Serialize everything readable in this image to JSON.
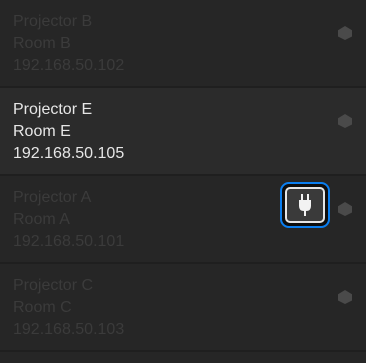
{
  "projectors": [
    {
      "name": "Projector B",
      "room": "Room B",
      "ip": "192.168.50.102",
      "selected": false
    },
    {
      "name": "Projector E",
      "room": "Room E",
      "ip": "192.168.50.105",
      "selected": true
    },
    {
      "name": "Projector A",
      "room": "Room A",
      "ip": "192.168.50.101",
      "selected": false
    },
    {
      "name": "Projector C",
      "room": "Room C",
      "ip": "192.168.50.103",
      "selected": false
    }
  ],
  "connect_button": {
    "icon": "plug-icon",
    "highlight_color": "#0a7ef0"
  },
  "colors": {
    "selected_text": "#e6e6e6",
    "dimmed_text": "#3b3b3b",
    "row_background": "#262626"
  }
}
